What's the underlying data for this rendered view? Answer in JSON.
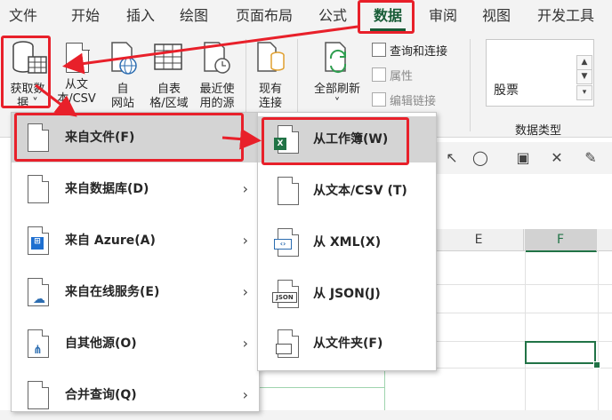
{
  "ribbon_tabs": [
    "文件",
    "开始",
    "插入",
    "绘图",
    "页面布局",
    "公式",
    "数据",
    "审阅",
    "视图",
    "开发工具"
  ],
  "active_tab": "数据",
  "ribbon": {
    "get_data": {
      "line1": "获取数",
      "line2": "据 ˅"
    },
    "from_text_csv": {
      "line1": "从文",
      "line2": "本/CSV"
    },
    "from_web": {
      "line1": "自",
      "line2": "网站"
    },
    "from_table": {
      "line1": "自表",
      "line2": "格/区域"
    },
    "recent_sources": {
      "line1": "最近使",
      "line2": "用的源"
    },
    "existing_conn": {
      "line1": "现有",
      "line2": "连接"
    },
    "refresh_all": {
      "line1": "全部刷新",
      "line2": "˅"
    },
    "queries_connections": "查询和连接",
    "properties": "属性",
    "edit_links": "编辑链接",
    "stocks": "股票",
    "data_types_group": "数据类型"
  },
  "menu_primary": [
    {
      "label": "来自文件(F)",
      "has_submenu": true,
      "highlighted": true
    },
    {
      "label": "来自数据库(D)",
      "has_submenu": true
    },
    {
      "label": "来自 Azure(A)",
      "has_submenu": true
    },
    {
      "label": "来自在线服务(E)",
      "has_submenu": true
    },
    {
      "label": "自其他源(O)",
      "has_submenu": true
    },
    {
      "label": "合并查询(Q)",
      "has_submenu": true
    }
  ],
  "menu_secondary": [
    {
      "label": "从工作簿(W)",
      "highlighted": true
    },
    {
      "label": "从文本/CSV (T)"
    },
    {
      "label": "从 XML(X)"
    },
    {
      "label": "从 JSON(J)"
    },
    {
      "label": "从文件夹(F)"
    }
  ],
  "sheet": {
    "columns": [
      "E",
      "F"
    ]
  },
  "colors": {
    "accent": "#217346",
    "highlight_red": "#e8202a",
    "menu_hover": "#d4d4d4"
  }
}
